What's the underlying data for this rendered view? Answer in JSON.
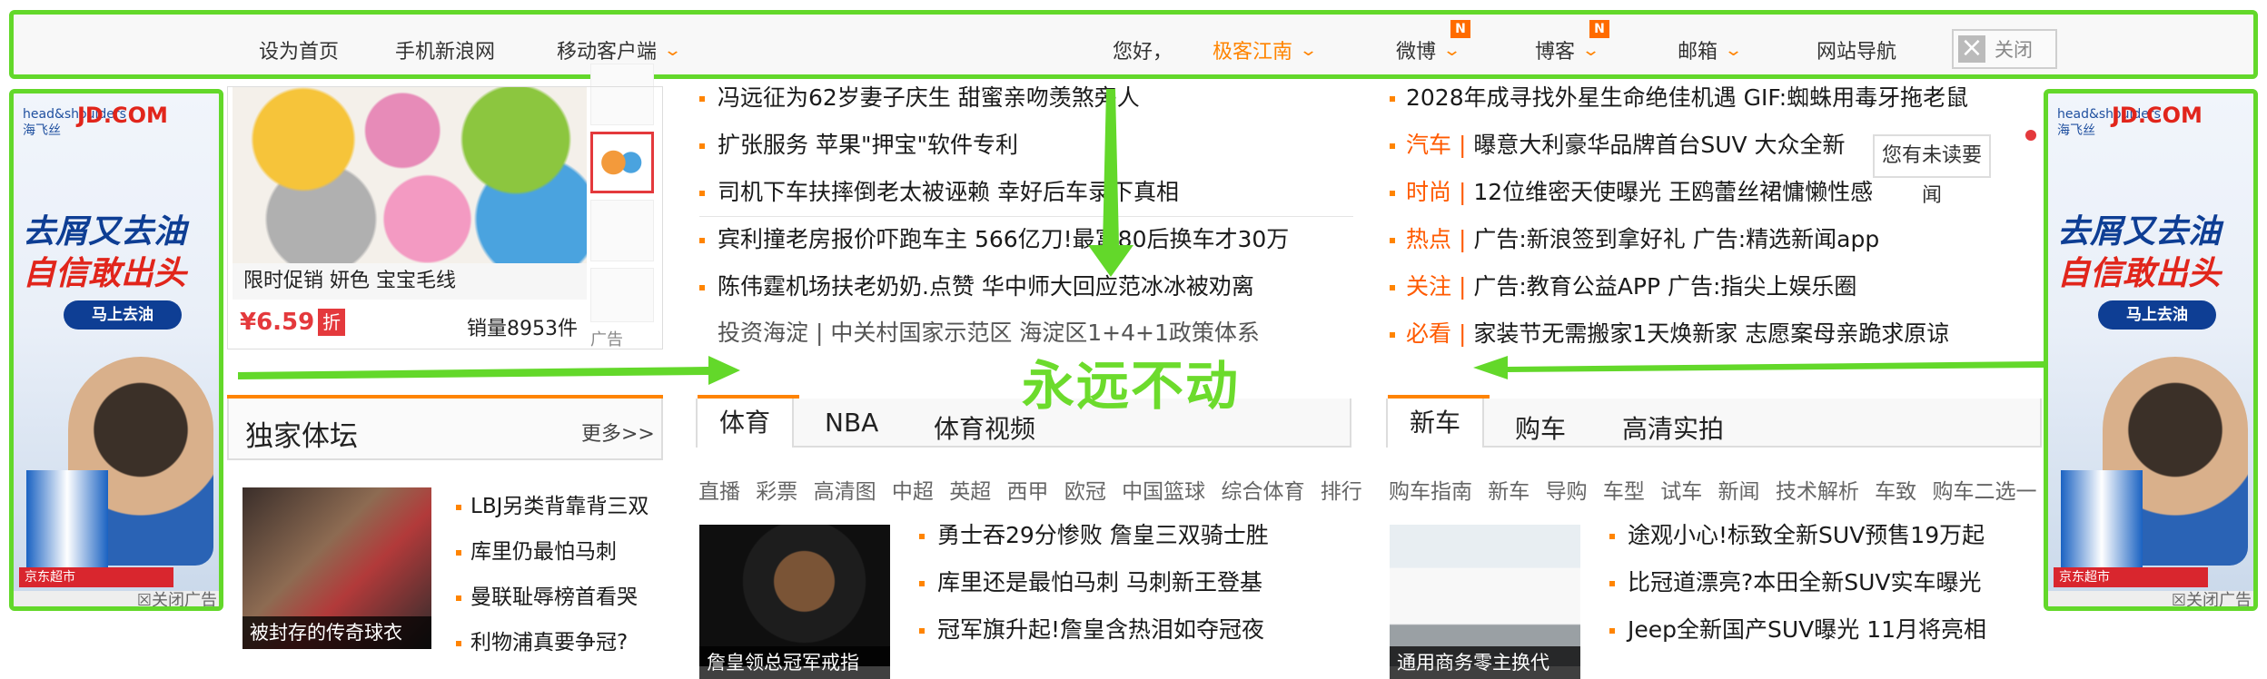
{
  "topbar": {
    "left_links": [
      "设为首页",
      "手机新浪网",
      "移动客户端"
    ],
    "greeting": "您好，",
    "user": "极客江南",
    "weibo": "微博",
    "blog": "博客",
    "mail": "邮箱",
    "nav": "网站导航",
    "close": "关闭",
    "badge": "N"
  },
  "side_ad": {
    "brand_small": "head&shoulders 海飞丝",
    "brand_logo": "JD.COM",
    "slogan_line1": "去屑又去油",
    "slogan_line2": "自信敢出头",
    "button": "马上去油",
    "store": "京东超市",
    "close": "关闭广告"
  },
  "product": {
    "caption": "限时促销 妍色 宝宝毛线",
    "price": "¥6.59",
    "discount": "折",
    "sold": "销量8953件",
    "ad": "广告"
  },
  "center_news": [
    "冯远征为62岁妻子庆生 甜蜜亲吻羡煞旁人",
    "扩张服务 苹果\"押宝\"软件专利",
    "司机下车扶摔倒老太被诬赖 幸好后车录下真相",
    "宾利撞老房报价吓跑车主 566亿刀!最富80后换车才30万",
    "陈伟霆机场扶老奶奶.点赞 华中师大回应范冰冰被劝离"
  ],
  "center_links": "投资海淀 | 中关村国家示范区 海淀区1+4+1政策体系",
  "right_news": [
    {
      "cat": "",
      "text": "2028年成寻找外星生命绝佳机遇 GIF:蜘蛛用毒牙拖老鼠"
    },
    {
      "cat": "汽车",
      "text": "曝意大利豪华品牌首台SUV 大众全新"
    },
    {
      "cat": "时尚",
      "text": "12位维密天使曝光 王鸥蕾丝裙慵懒性感"
    },
    {
      "cat": "热点",
      "text": "广告:新浪签到拿好礼 广告:精选新闻app"
    },
    {
      "cat": "关注",
      "text": "广告:教育公益APP 广告:指尖上娱乐圈"
    },
    {
      "cat": "必看",
      "text": "家装节无需搬家1天焕新家 志愿案母亲跪求原谅"
    }
  ],
  "unread": "您有未读要闻",
  "annotation": "永远不动",
  "forum": {
    "title": "独家体坛",
    "more": "更多>>",
    "photo_caption": "被封存的传奇球衣",
    "items": [
      "LBJ另类背靠背三双",
      "库里仍最怕马刺",
      "曼联耻辱榜首看哭",
      "利物浦真要争冠?"
    ]
  },
  "sports": {
    "tabs": [
      "体育",
      "NBA",
      "体育视频"
    ],
    "sublinks": "直播 彩票 高清图 中超 英超 西甲 欧冠 中国篮球 综合体育 排行",
    "photo_caption": "詹皇领总冠军戒指",
    "items": [
      "勇士吞29分惨败 詹皇三双骑士胜",
      "库里还是最怕马刺 马刺新王登基",
      "冠军旗升起!詹皇含热泪如夺冠夜"
    ]
  },
  "cars": {
    "tabs": [
      "新车",
      "购车",
      "高清实拍"
    ],
    "sublinks": "购车指南 新车 导购 车型 试车 新闻 技术解析 车致 购车二选一",
    "photo_caption": "通用商务零主换代",
    "items": [
      "途观小心!标致全新SUV预售19万起",
      "比冠道漂亮?本田全新SUV实车曝光",
      "Jeep全新国产SUV曝光 11月将亮相"
    ]
  },
  "colors": {
    "accent": "#ff8400",
    "annotation": "#63d82a",
    "red": "#e4393c"
  }
}
